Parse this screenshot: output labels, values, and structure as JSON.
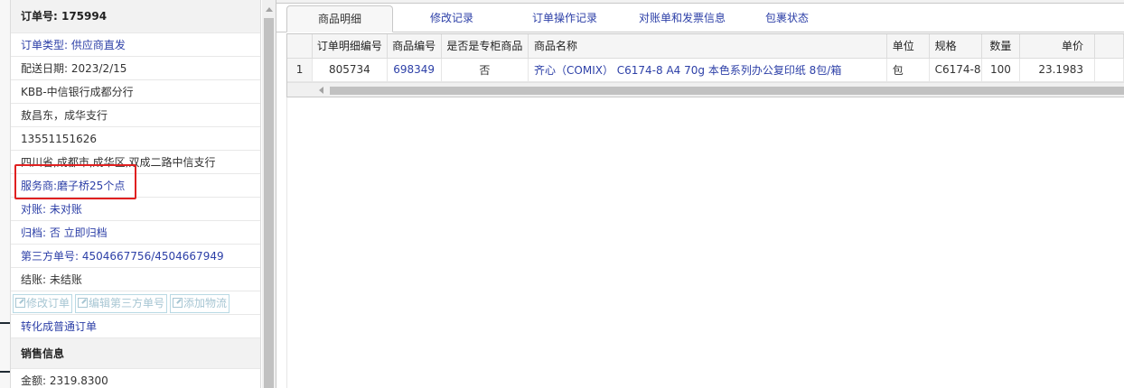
{
  "order": {
    "number_label": "订单号: 175994",
    "type_label": "订单类型: 供应商直发",
    "delivery_date": "配送日期: 2023/2/15",
    "customer": "KBB-中信银行成都分行",
    "contact": "敖昌东，成华支行",
    "phone": "13551151626",
    "address": "四川省,成都市,成华区,双成二路中信支行",
    "service_provider": "服务商:磨子桥25个点",
    "reconcile": "对账: 未对账",
    "archive": "归档:  否 立即归档",
    "third_party_no": "第三方单号: 4504667756/4504667949",
    "settlement": "结账: 未结账",
    "convert_link": "转化成普通订单"
  },
  "actions": {
    "edit_order": "修改订单",
    "edit_third_party": "编辑第三方单号",
    "add_logistics": "添加物流"
  },
  "sales": {
    "section_title": "销售信息",
    "amount": "金额: 2319.8300"
  },
  "tabs": [
    {
      "label": "商品明细",
      "active": true
    },
    {
      "label": "修改记录",
      "active": false
    },
    {
      "label": "订单操作记录",
      "active": false
    },
    {
      "label": "对账单和发票信息",
      "active": false
    },
    {
      "label": "包裹状态",
      "active": false
    }
  ],
  "grid": {
    "columns": [
      "订单明细编号",
      "商品编号",
      "是否是专柜商品",
      "商品名称",
      "单位",
      "规格",
      "数量",
      "单价"
    ],
    "rows": [
      {
        "index": "1",
        "detail_id": "805734",
        "product_id": "698349",
        "counter": "否",
        "name": "齐心（COMIX） C6174-8 A4 70g 本色系列办公复印纸 8包/箱",
        "unit": "包",
        "spec": "C6174-8",
        "qty": "100",
        "price": "23.1983"
      }
    ]
  },
  "colors": {
    "link": "#2c3fa7",
    "highlight": "#e02020",
    "header_bg": "#f2f2f2"
  }
}
